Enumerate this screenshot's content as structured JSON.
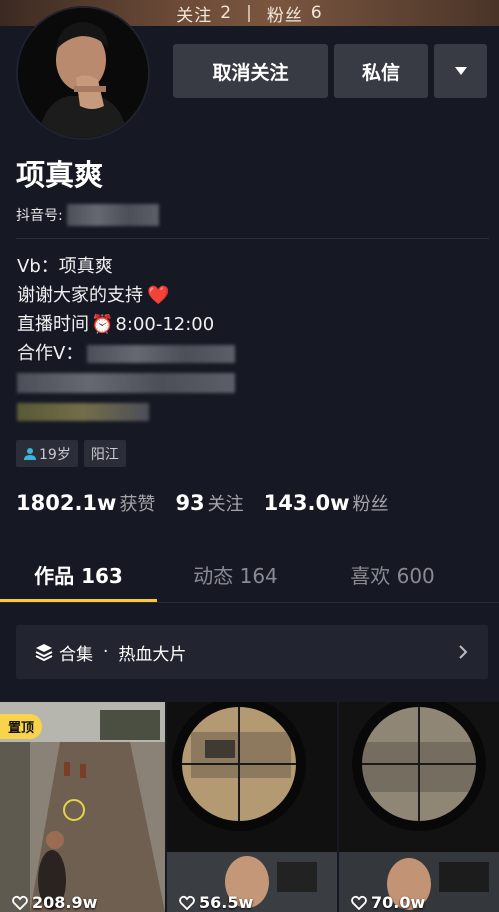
{
  "topbar": {
    "following_label": "关注",
    "following_count": "2",
    "separator": "|",
    "fans_label": "粉丝",
    "fans_count": "6"
  },
  "actions": {
    "unfollow": "取消关注",
    "message": "私信",
    "more_icon": "triangle-down-icon"
  },
  "profile": {
    "name": "项真爽",
    "douyin_id_label": "抖音号:",
    "bio": [
      {
        "text": "Vb：项真爽",
        "emoji": ""
      },
      {
        "text": "谢谢大家的支持",
        "emoji": "❤️"
      },
      {
        "text": "直播时间",
        "emoji": "⏰",
        "suffix": "8:00-12:00"
      },
      {
        "text": "合作V：",
        "emoji": ""
      }
    ],
    "tags": {
      "age": "19岁",
      "location": "阳江"
    }
  },
  "stats": {
    "likes_value": "1802.1w",
    "likes_label": "获赞",
    "following_value": "93",
    "following_label": "关注",
    "fans_value": "143.0w",
    "fans_label": "粉丝"
  },
  "tabs": [
    {
      "label": "作品 163",
      "active": true
    },
    {
      "label": "动态 164",
      "active": false
    },
    {
      "label": "喜欢 600",
      "active": false
    }
  ],
  "collection": {
    "label": "合集",
    "dot": "·",
    "title": "热血大片",
    "icon": "layers-icon",
    "chevron": "chevron-right-icon"
  },
  "videos": [
    {
      "pinned_label": "置顶",
      "likes": "208.9w"
    },
    {
      "likes": "56.5w"
    },
    {
      "likes": "70.0w"
    }
  ],
  "colors": {
    "background": "#161823",
    "accent": "#f8c932",
    "button": "#393b44"
  }
}
